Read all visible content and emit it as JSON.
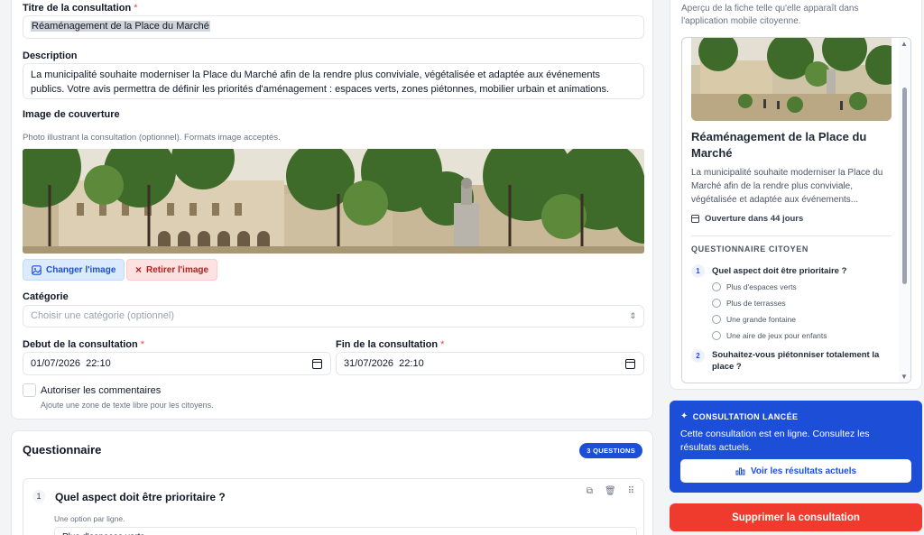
{
  "form": {
    "title_label": "Titre de la consultation",
    "required_mark": "*",
    "title_value": "Réaménagement de la Place du Marché",
    "description_label": "Description",
    "description_value": "La municipalité souhaite moderniser la Place du Marché afin de la rendre plus conviviale, végétalisée et adaptée aux événements publics. Votre avis permettra de définir les priorités d'aménagement : espaces verts, zones piétonnes, mobilier urbain et animations.",
    "cover_label": "Image de couverture",
    "cover_hint": "Photo illustrant la consultation (optionnel). Formats image acceptés.",
    "change_image_label": "Changer l'image",
    "remove_image_label": "Retirer l'image",
    "category_label": "Catégorie",
    "category_placeholder": "Choisir une catégorie (optionnel)",
    "start_label": "Debut de la consultation",
    "start_value": "01/07/2026  22:10",
    "end_label": "Fin de la consultation",
    "end_value": "31/07/2026  22:10",
    "comments_label": "Autoriser les commentaires",
    "comments_hint": "Ajoute une zone de texte libre pour les citoyens.",
    "comments_checked": false
  },
  "questionnaire": {
    "title": "Questionnaire",
    "count_badge": "3 QUESTIONS",
    "first_question": {
      "number": "1",
      "text": "Quel aspect doit être prioritaire ?",
      "hint": "Une option par ligne.",
      "options_value": "Plus d'espaces verts"
    }
  },
  "preview": {
    "hint": "Aperçu de la fiche telle qu'elle apparaît dans l'application mobile citoyenne.",
    "title": "Réaménagement de la Place du Marché",
    "description": "La municipalité souhaite moderniser la Place du Marché afin de la rendre plus conviviale, végétalisée et adaptée aux événements...",
    "opening": "Ouverture dans 44 jours",
    "section_title": "QUESTIONNAIRE CITOYEN",
    "questions": [
      {
        "number": "1",
        "text": "Quel aspect doit être prioritaire ?",
        "options": [
          "Plus d'espaces verts",
          "Plus de terrasses",
          "Une grande fontaine",
          "Une aire de jeux pour enfants"
        ]
      },
      {
        "number": "2",
        "text": "Souhaitez-vous piétonniser totalement la place ?"
      }
    ]
  },
  "launch": {
    "heading": "CONSULTATION LANCÉE",
    "text": "Cette consultation est en ligne. Consultez les résultats actuels.",
    "results_button": "Voir les résultats actuels"
  },
  "delete_button": "Supprimer la consultation",
  "colors": {
    "primary": "#1d4ed8",
    "danger": "#ef3b2d",
    "required": "#ef4444"
  }
}
